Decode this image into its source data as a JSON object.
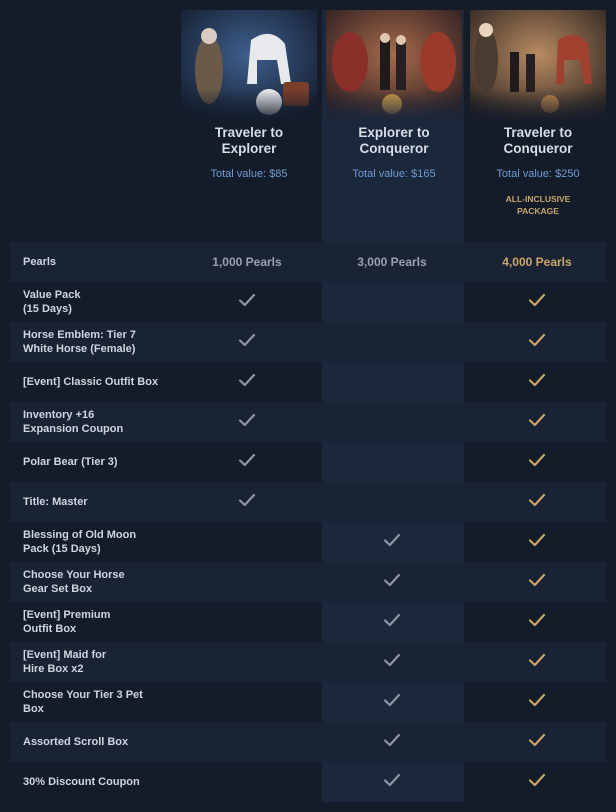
{
  "packages": [
    {
      "title": "Traveler to\nExplorer",
      "value": "Total value: $85",
      "badge": ""
    },
    {
      "title": "Explorer to\nConqueror",
      "value": "Total value: $165",
      "badge": ""
    },
    {
      "title": "Traveler to\nConqueror",
      "value": "Total value: $250",
      "badge": "ALL-INCLUSIVE\nPACKAGE"
    }
  ],
  "pearls": {
    "label": "Pearls",
    "values": [
      "1,000 Pearls",
      "3,000 Pearls",
      "4,000 Pearls"
    ]
  },
  "rows": [
    {
      "label": "Value Pack\n(15 Days)",
      "checks": [
        true,
        false,
        true
      ]
    },
    {
      "label": "Horse Emblem: Tier 7\nWhite Horse (Female)",
      "checks": [
        true,
        false,
        true
      ]
    },
    {
      "label": "[Event] Classic Outfit Box",
      "checks": [
        true,
        false,
        true
      ]
    },
    {
      "label": "Inventory +16\nExpansion Coupon",
      "checks": [
        true,
        false,
        true
      ]
    },
    {
      "label": "Polar Bear (Tier 3)",
      "checks": [
        true,
        false,
        true
      ]
    },
    {
      "label": "Title: Master",
      "checks": [
        true,
        false,
        true
      ]
    },
    {
      "label": "Blessing of Old Moon\nPack (15 Days)",
      "checks": [
        false,
        true,
        true
      ]
    },
    {
      "label": "Choose Your Horse\nGear Set Box",
      "checks": [
        false,
        true,
        true
      ]
    },
    {
      "label": "[Event] Premium\nOutfit Box",
      "checks": [
        false,
        true,
        true
      ]
    },
    {
      "label": "[Event] Maid for\nHire Box x2",
      "checks": [
        false,
        true,
        true
      ]
    },
    {
      "label": "Choose Your Tier 3 Pet\nBox",
      "checks": [
        false,
        true,
        true
      ]
    },
    {
      "label": "Assorted Scroll Box",
      "checks": [
        false,
        true,
        true
      ]
    },
    {
      "label": "30% Discount Coupon",
      "checks": [
        false,
        true,
        true
      ]
    }
  ],
  "colors": {
    "check_standard": "#8f96a3",
    "check_premium": "#c9a66b",
    "accent_blue": "#6f9bd1",
    "gold": "#c9a66b"
  }
}
